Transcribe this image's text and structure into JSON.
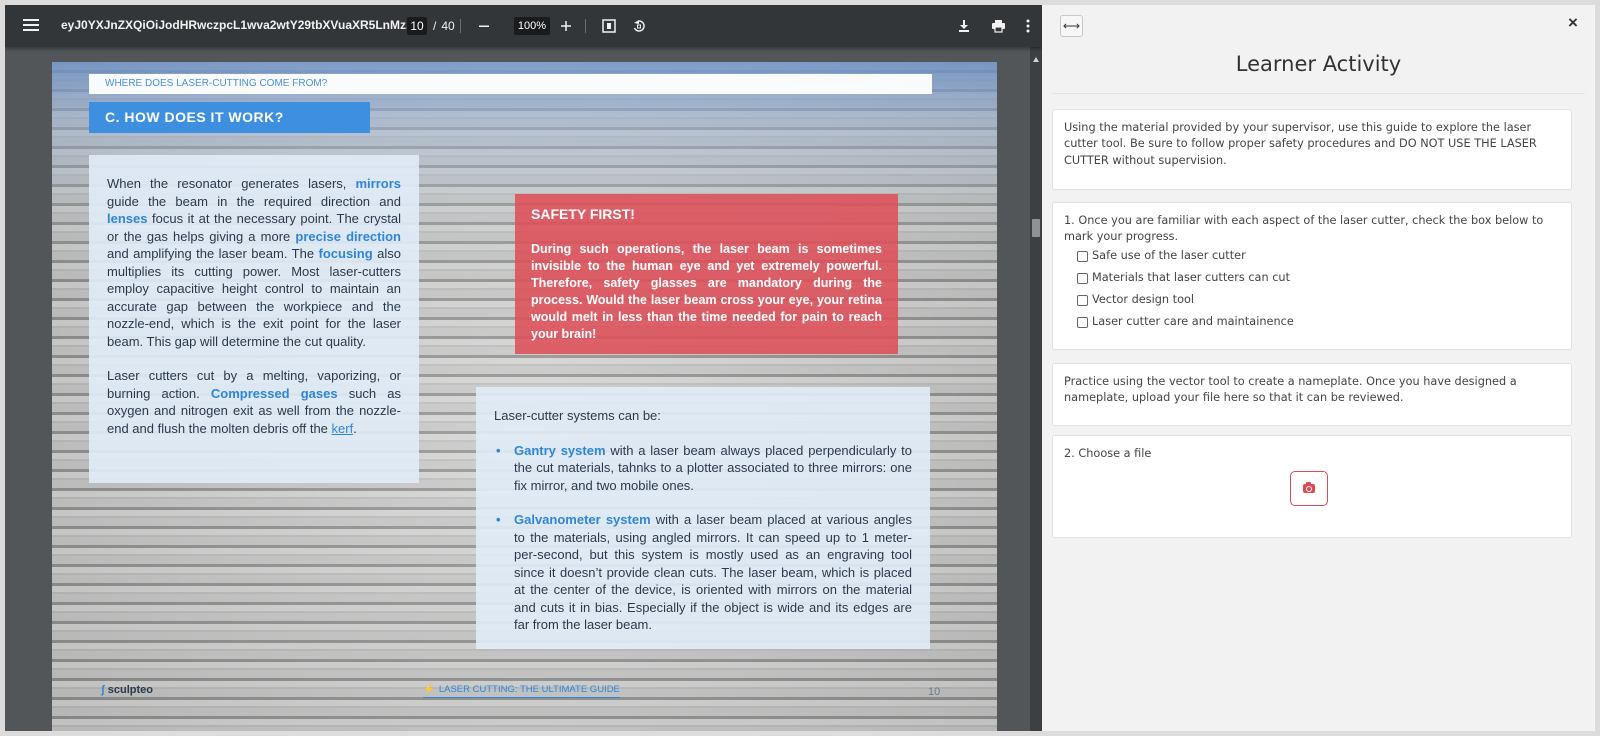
{
  "viewer": {
    "file_title": "eyJ0YXJnZXQiOiJodHRwczpcL1wva2wtY29tbXVuaXR5LnMz...",
    "page_current": "10",
    "page_total": "40",
    "page_sep": "/",
    "zoom": "100%",
    "icons": {
      "menu": "menu-icon",
      "zoom_out": "minus-icon",
      "zoom_in": "plus-icon",
      "fit": "fit-page-icon",
      "rotate": "rotate-icon",
      "download": "download-icon",
      "print": "print-icon",
      "more": "more-vertical-icon"
    }
  },
  "pdf_page": {
    "header": "WHERE DOES LASER-CUTTING COME FROM?",
    "section_title": "C. HOW DOES IT WORK?",
    "left_p1": {
      "t1": "When the resonator generates lasers, ",
      "h1": "mirrors",
      "t2": " guide the beam in the required direction and ",
      "h2": "lenses",
      "t3": " focus it at the necessary point. The crystal or the gas helps giving a more ",
      "h3": "precise direction",
      "t4": " and amplifying the laser beam. The ",
      "h4": "focusing",
      "t5": " also multiplies its cutting power. Most laser-cutters employ capacitive height control to maintain an accurate gap between the workpiece and the nozzle-end, which is the exit point for the laser beam. This gap will determine the cut quality."
    },
    "left_p2": {
      "t1": "Laser cutters cut by a melting, vaporizing, or burning action. ",
      "h1": "Compressed gases",
      "t2": " such as oxygen and nitrogen exit as well from the nozzle-end and flush the molten debris off the ",
      "link": "kerf",
      "t3": "."
    },
    "safety_title": "SAFETY FIRST!",
    "safety_text": "During such operations, the laser beam is sometimes invisible to the human eye and yet extremely powerful. Therefore, safety glasses are mandatory during the process. Would the laser beam cross your eye, your retina would melt in less than the time needed for pain to reach your brain!",
    "systems_intro": "Laser-cutter systems can be:",
    "systems": [
      {
        "name": "Gantry system",
        "text": " with a laser beam always placed perpendicularly to the cut materials, tahnks to a plotter associated to three mirrors: one fix mirror, and two mobile ones."
      },
      {
        "name": "Galvanometer system",
        "text": " with a laser beam placed at various angles to the materials, using angled mirrors. It can speed up to 1 meter-per-second, but this system is mostly used as an engraving tool since it doesn’t provide clean cuts. The laser beam, which is placed at the center of the device, is oriented with mirrors on the material and cuts it in bias. Especially if the object is wide and its edges are far from the laser beam."
      }
    ],
    "footer_logo": "sculpteo",
    "footer_title": "LASER CUTTING: THE ULTIMATE GUIDE",
    "footer_page": "10"
  },
  "panel": {
    "title": "Learner Activity",
    "intro": "Using the material provided by your supervisor, use this guide to explore the laser cutter tool. Be sure to follow proper safety procedures and DO NOT USE THE LASER CUTTER without supervision.",
    "q1": "1. Once you are familiar with each aspect of the laser cutter, check the box below to mark your progress.",
    "checklist": [
      "Safe use of the laser cutter",
      "Materials that laser cutters can cut",
      "Vector design tool",
      "Laser cutter care and maintainence"
    ],
    "practice": "Practice using the vector tool to create a nameplate. Once you have designed a nameplate, upload your file here so that it can be reviewed.",
    "q2": "2. Choose a file",
    "close_glyph": "×",
    "expand_glyph": "⟷",
    "upload_icon": "camera-icon",
    "accent": "#e04a55"
  }
}
